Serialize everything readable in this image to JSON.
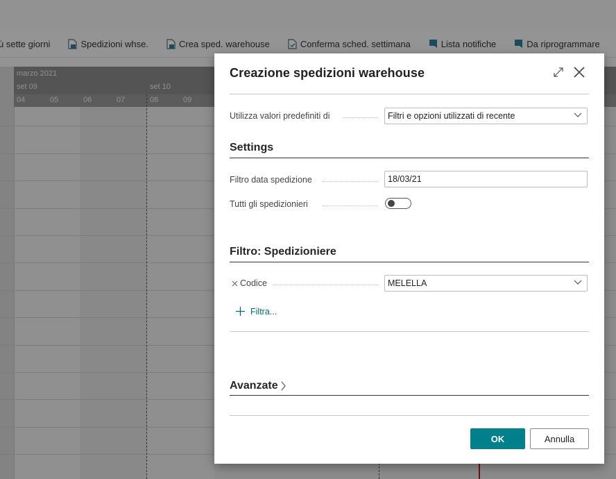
{
  "toolbar": {
    "items": [
      {
        "label": "ù sette giorni"
      },
      {
        "label": "Spedizioni whse."
      },
      {
        "label": "Crea sped. warehouse"
      },
      {
        "label": "Conferma sched. settimana"
      },
      {
        "label": "Lista notifiche"
      },
      {
        "label": "Da riprogrammare"
      }
    ]
  },
  "timeline": {
    "month": "marzo 2021",
    "weeks": [
      "set 09",
      "set 10"
    ],
    "days": [
      "04",
      "05",
      "06",
      "07",
      "08",
      "09"
    ]
  },
  "dialog": {
    "title": "Creazione spedizioni warehouse",
    "defaults_label": "Utilizza valori predefiniti di",
    "defaults_value": "Filtri e opzioni utilizzati di recente",
    "settings_heading": "Settings",
    "date_filter_label": "Filtro data spedizione",
    "date_filter_value": "18/03/21",
    "all_shippers_label": "Tutti gli spedizionieri",
    "all_shippers_on": false,
    "filter_heading": "Filtro: Spedizioniere",
    "code_label": "Codice",
    "code_value": "MELELLA",
    "add_filter_label": "Filtra...",
    "advanced_heading": "Avanzate",
    "ok_label": "OK",
    "cancel_label": "Annulla"
  },
  "colors": {
    "accent": "#00808b"
  }
}
